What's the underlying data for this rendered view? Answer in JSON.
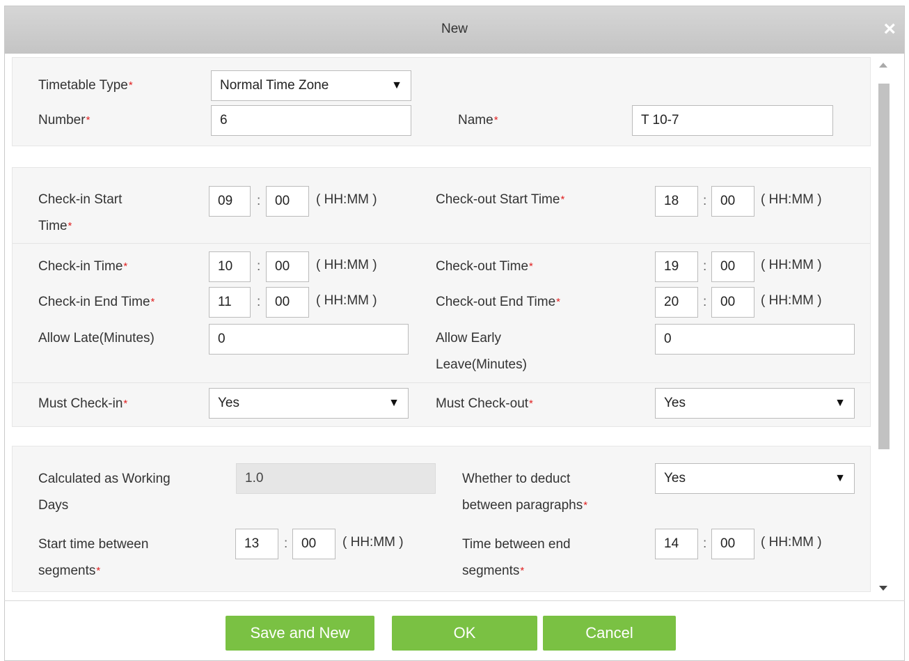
{
  "dialog": {
    "title": "New",
    "close_symbol": "×"
  },
  "basic": {
    "timetable_type": {
      "label": "Timetable Type",
      "value": "Normal Time Zone"
    },
    "number": {
      "label": "Number",
      "value": "6"
    },
    "name": {
      "label": "Name",
      "value": "T 10-7"
    }
  },
  "times": {
    "checkin_start": {
      "label_line1": "Check-in Start",
      "label_line2": "Time",
      "hh": "09",
      "mm": "00"
    },
    "checkin": {
      "label": "Check-in Time",
      "hh": "10",
      "mm": "00"
    },
    "checkin_end": {
      "label": "Check-in End Time",
      "hh": "11",
      "mm": "00"
    },
    "checkout_start": {
      "label": "Check-out Start Time",
      "hh": "18",
      "mm": "00"
    },
    "checkout": {
      "label": "Check-out Time",
      "hh": "19",
      "mm": "00"
    },
    "checkout_end": {
      "label": "Check-out End Time",
      "hh": "20",
      "mm": "00"
    },
    "format": "( HH:MM )",
    "separator": ":",
    "allow_late": {
      "label": "Allow Late(Minutes)",
      "value": "0"
    },
    "allow_early": {
      "label_line1": "Allow Early",
      "label_line2": "Leave(Minutes)",
      "value": "0"
    },
    "must_checkin": {
      "label": "Must Check-in",
      "value": "Yes"
    },
    "must_checkout": {
      "label": "Must Check-out",
      "value": "Yes"
    }
  },
  "segments": {
    "working_days": {
      "label_line1": "Calculated as Working",
      "label_line2": "Days",
      "value": "1.0"
    },
    "deduct": {
      "label_line1": "Whether to deduct",
      "label_line2": "between paragraphs",
      "value": "Yes"
    },
    "start_between": {
      "label_line1": "Start time between",
      "label_line2": "segments",
      "hh": "13",
      "mm": "00"
    },
    "end_between": {
      "label_line1": "Time between end",
      "label_line2": "segments",
      "hh": "14",
      "mm": "00"
    }
  },
  "required_mark": "*",
  "dropdown_arrow": "▼",
  "buttons": {
    "save_new": "Save and New",
    "ok": "OK",
    "cancel": "Cancel"
  },
  "colors": {
    "accent_green": "#7ac143",
    "required_red": "#e02020"
  }
}
